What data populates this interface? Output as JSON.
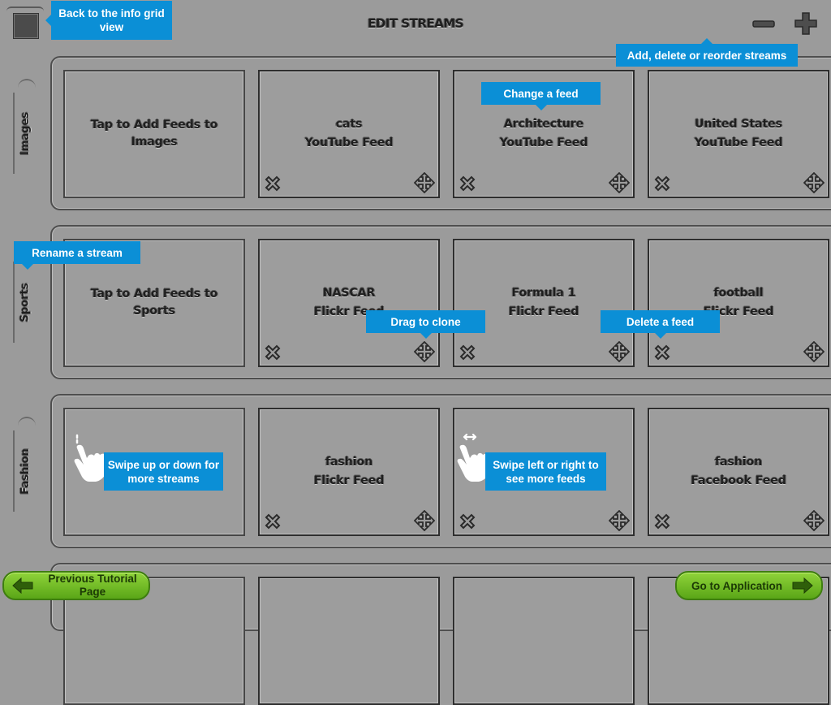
{
  "header": {
    "title": "EDIT STREAMS",
    "icons": [
      "grid-view",
      "minus",
      "plus"
    ]
  },
  "streams": [
    {
      "name": "Images",
      "add_text": "Tap to Add Feeds to Images",
      "feeds": [
        {
          "title": "cats",
          "type": "YouTube Feed"
        },
        {
          "title": "Architecture",
          "type": "YouTube Feed"
        },
        {
          "title": "United States",
          "type": "YouTube Feed"
        }
      ]
    },
    {
      "name": "Sports",
      "add_text": "Tap to Add Feeds to Sports",
      "feeds": [
        {
          "title": "NASCAR",
          "type": "Flickr Feed"
        },
        {
          "title": "Formula 1",
          "type": "Flickr Feed"
        },
        {
          "title": "football",
          "type": "Flickr Feed"
        }
      ]
    },
    {
      "name": "Fashion",
      "feeds": [
        {
          "title": "fashion",
          "type": "Flickr Feed"
        },
        {
          "title": "fashion",
          "type": "Facebook Feed"
        }
      ]
    }
  ],
  "callouts": {
    "back_to_grid": "Back to the info grid view",
    "add_delete_reorder": "Add, delete or reorder streams",
    "change_feed": "Change a feed",
    "rename_stream": "Rename a stream",
    "drag_clone": "Drag to clone",
    "delete_feed": "Delete a feed",
    "swipe_up_down": "Swipe up or down for more streams",
    "swipe_left_right": "Swipe left or right to see more feeds"
  },
  "footer": {
    "previous": "Previous Tutorial Page",
    "go_to_app": "Go to Application"
  },
  "colors": {
    "background": "#9b9b9b",
    "callout": "#0b8fd6",
    "button_green": "#6fbf22"
  }
}
